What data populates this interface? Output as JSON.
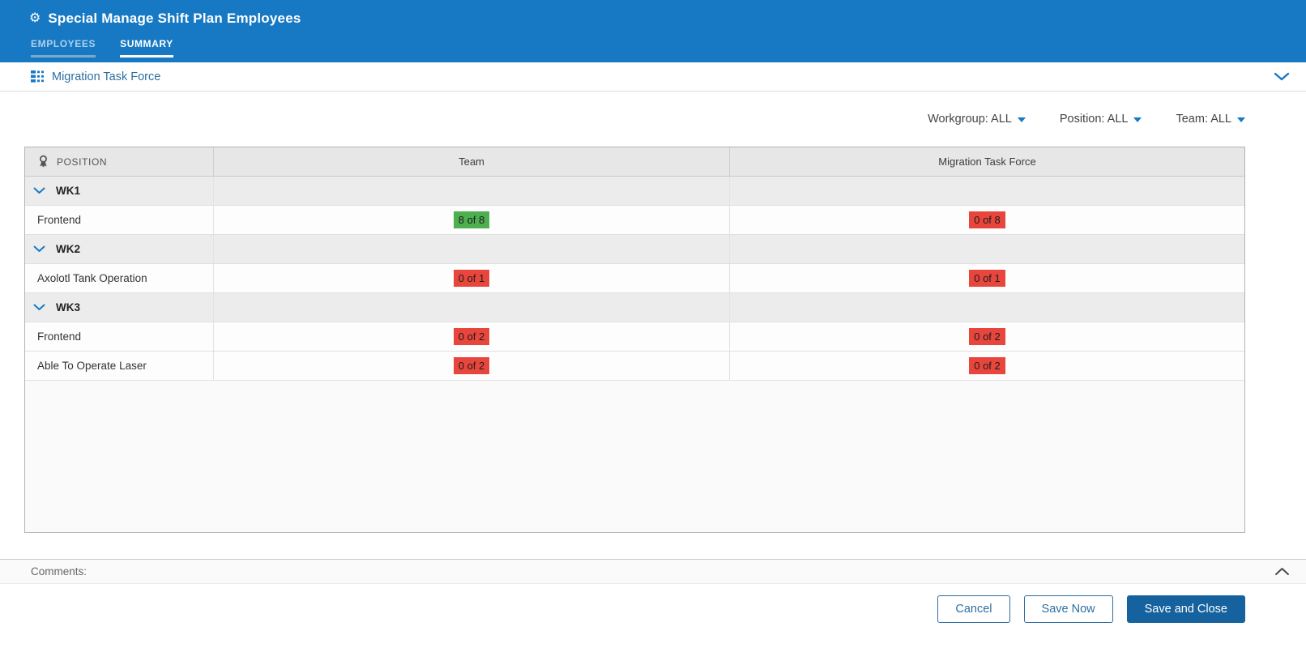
{
  "window": {
    "title": "Special Manage Shift Plan Employees"
  },
  "tabs": [
    {
      "label": "EMPLOYEES",
      "active": false
    },
    {
      "label": "SUMMARY",
      "active": true
    }
  ],
  "section": {
    "title": "Migration Task Force"
  },
  "filters": [
    {
      "label": "Workgroup: ALL"
    },
    {
      "label": "Position: ALL"
    },
    {
      "label": "Team: ALL"
    }
  ],
  "table": {
    "position_header": "POSITION",
    "columns": [
      "Team",
      "Migration Task Force"
    ],
    "rows": [
      {
        "type": "group",
        "label": "WK1"
      },
      {
        "type": "data",
        "label": "Frontend",
        "cells": [
          {
            "text": "8 of 8",
            "status": "ok"
          },
          {
            "text": "0 of 8",
            "status": "bad"
          }
        ]
      },
      {
        "type": "group",
        "label": "WK2"
      },
      {
        "type": "data",
        "label": "Axolotl Tank Operation",
        "cells": [
          {
            "text": "0 of 1",
            "status": "bad"
          },
          {
            "text": "0 of 1",
            "status": "bad"
          }
        ]
      },
      {
        "type": "group",
        "label": "WK3"
      },
      {
        "type": "data",
        "label": "Frontend",
        "cells": [
          {
            "text": "0 of 2",
            "status": "bad"
          },
          {
            "text": "0 of 2",
            "status": "bad"
          }
        ]
      },
      {
        "type": "data",
        "label": "Able To Operate Laser",
        "cells": [
          {
            "text": "0 of 2",
            "status": "bad"
          },
          {
            "text": "0 of 2",
            "status": "bad"
          }
        ]
      }
    ]
  },
  "comments": {
    "label": "Comments:"
  },
  "footer": {
    "buttons": [
      {
        "label": "Cancel",
        "kind": "outline"
      },
      {
        "label": "Save Now",
        "kind": "outline"
      },
      {
        "label": "Save and Close",
        "kind": "primary"
      }
    ]
  },
  "colors": {
    "header_blue": "#1779c4",
    "accent_blue": "#2d6f9f",
    "badge_green": "#4caf50",
    "badge_red": "#e8463d",
    "primary_button_blue": "#16629e"
  }
}
